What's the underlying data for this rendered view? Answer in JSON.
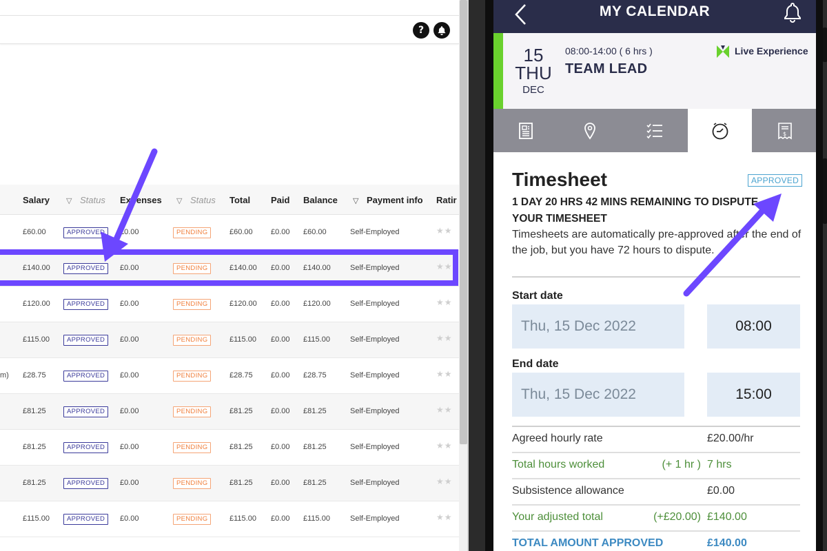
{
  "left": {
    "help_icon": "?",
    "columns": {
      "salary": "Salary",
      "status1": "Status",
      "expenses": "Expenses",
      "status2": "Status",
      "total": "Total",
      "paid": "Paid",
      "balance": "Balance",
      "payment_info": "Payment info",
      "rating": "Ratir"
    },
    "rows": [
      {
        "name_tail": "",
        "salary": "£60.00",
        "status": "APPROVED",
        "expenses": "£0.00",
        "exp_status": "PENDING",
        "total": "£60.00",
        "paid": "£0.00",
        "balance": "£60.00",
        "payment": "Self-Employed"
      },
      {
        "name_tail": "",
        "salary": "£140.00",
        "status": "APPROVED",
        "expenses": "£0.00",
        "exp_status": "PENDING",
        "total": "£140.00",
        "paid": "£0.00",
        "balance": "£140.00",
        "payment": "Self-Employed"
      },
      {
        "name_tail": "",
        "salary": "£120.00",
        "status": "APPROVED",
        "expenses": "£0.00",
        "exp_status": "PENDING",
        "total": "£120.00",
        "paid": "£0.00",
        "balance": "£120.00",
        "payment": "Self-Employed"
      },
      {
        "name_tail": "",
        "salary": "£115.00",
        "status": "APPROVED",
        "expenses": "£0.00",
        "exp_status": "PENDING",
        "total": "£115.00",
        "paid": "£0.00",
        "balance": "£115.00",
        "payment": "Self-Employed"
      },
      {
        "name_tail": "m)",
        "salary": "£28.75",
        "status": "APPROVED",
        "expenses": "£0.00",
        "exp_status": "PENDING",
        "total": "£28.75",
        "paid": "£0.00",
        "balance": "£28.75",
        "payment": "Self-Employed"
      },
      {
        "name_tail": "",
        "salary": "£81.25",
        "status": "APPROVED",
        "expenses": "£0.00",
        "exp_status": "PENDING",
        "total": "£81.25",
        "paid": "£0.00",
        "balance": "£81.25",
        "payment": "Self-Employed"
      },
      {
        "name_tail": "",
        "salary": "£81.25",
        "status": "APPROVED",
        "expenses": "£0.00",
        "exp_status": "PENDING",
        "total": "£81.25",
        "paid": "£0.00",
        "balance": "£81.25",
        "payment": "Self-Employed"
      },
      {
        "name_tail": "",
        "salary": "£81.25",
        "status": "APPROVED",
        "expenses": "£0.00",
        "exp_status": "PENDING",
        "total": "£81.25",
        "paid": "£0.00",
        "balance": "£81.25",
        "payment": "Self-Employed"
      },
      {
        "name_tail": "",
        "salary": "£115.00",
        "status": "APPROVED",
        "expenses": "£0.00",
        "exp_status": "PENDING",
        "total": "£115.00",
        "paid": "£0.00",
        "balance": "£115.00",
        "payment": "Self-Employed"
      }
    ],
    "stars_glyph": "★★",
    "highlighted_row_index": 1
  },
  "app": {
    "title": "MY CALENDAR",
    "job": {
      "day": "15",
      "weekday": "THU",
      "month": "DEC",
      "time": "08:00-14:00 ( 6 hrs )",
      "role": "TEAM LEAD",
      "brand": "Live Experience"
    },
    "tabs": [
      "details",
      "location",
      "checklist",
      "timesheet",
      "receipt"
    ],
    "active_tab": "timesheet",
    "timesheet": {
      "title": "Timesheet",
      "status": "APPROVED",
      "dispute": "1 DAY 20 HRS 42 MINS REMAINING TO DISPUTE YOUR TIMESHEET",
      "explain": "Timesheets are automatically pre-approved after the end of the job, but you have 72 hours to dispute.",
      "start_label": "Start date",
      "start_date": "Thu, 15 Dec 2022",
      "start_time": "08:00",
      "end_label": "End date",
      "end_date": "Thu, 15 Dec 2022",
      "end_time": "15:00",
      "summary": [
        {
          "key": "Agreed hourly rate",
          "mod": "",
          "value": "£20.00/hr",
          "style": ""
        },
        {
          "key": "Total hours worked",
          "mod": "(+ 1 hr )",
          "value": "7 hrs",
          "style": "green"
        },
        {
          "key": "Subsistence allowance",
          "mod": "",
          "value": "£0.00",
          "style": ""
        },
        {
          "key": "Your adjusted total",
          "mod": "(+£20.00)",
          "value": "£140.00",
          "style": "green"
        },
        {
          "key": "TOTAL AMOUNT APPROVED",
          "mod": "",
          "value": "£140.00",
          "style": "blue"
        }
      ]
    }
  },
  "colors": {
    "annotation": "#6c47ff",
    "header_navy": "#2a2d4a",
    "accent_green": "#6ad12e",
    "approved_blue": "#4aa3cf",
    "pending_orange": "#f07f3c"
  }
}
